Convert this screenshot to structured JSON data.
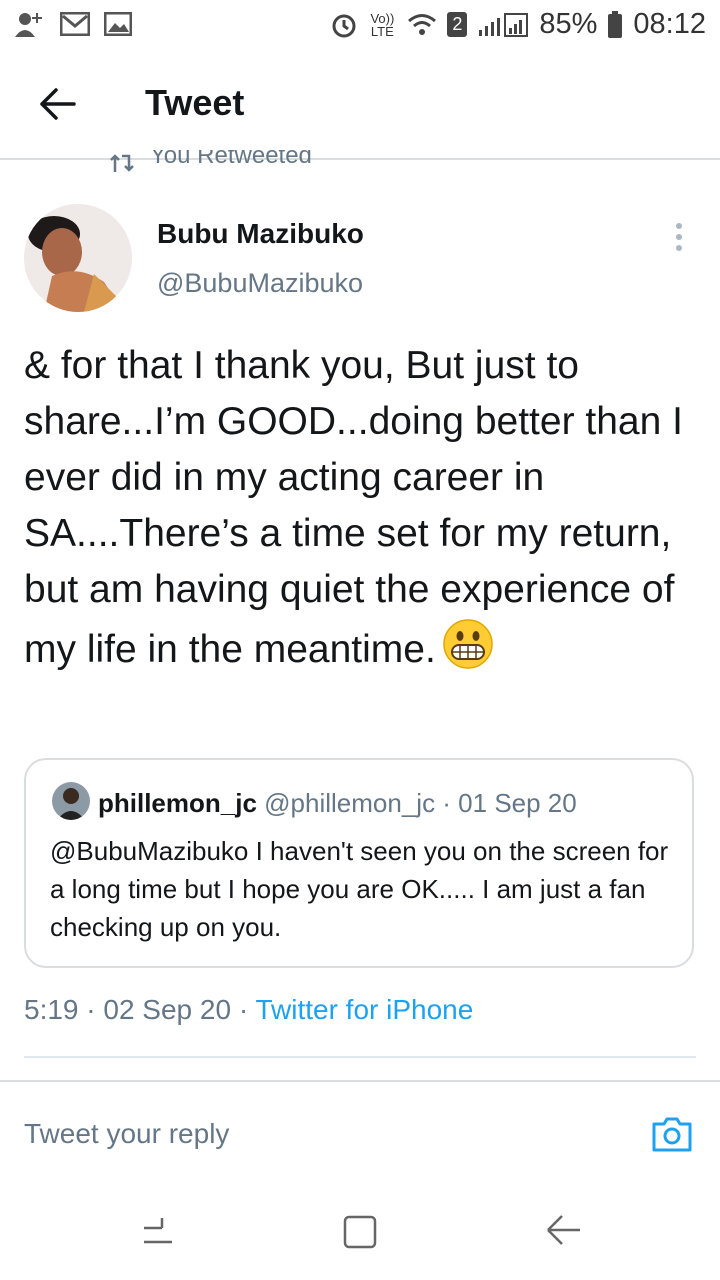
{
  "status_bar": {
    "volte": "Vo)) LTE",
    "sim": "2",
    "battery": "85%",
    "time": "08:12",
    "icons": [
      "add-contact-icon",
      "gmail-icon",
      "image-icon",
      "alarm-icon",
      "wifi-icon",
      "signal-icon",
      "battery-icon"
    ]
  },
  "header": {
    "title": "Tweet",
    "back_icon": "back-arrow-icon"
  },
  "retweet_notice": {
    "text": "You Retweeted",
    "icon": "retweet-icon"
  },
  "tweet": {
    "author_name": "Bubu Mazibuko",
    "author_handle": "@BubuMazibuko",
    "text": "& for that I thank you, But just to share...I’m GOOD...doing better than I ever did in my acting career in SA....There’s a time set for my return, but am having quiet the experience of my life in the meantime.",
    "emoji": "grinning-face-icon",
    "time": "5:19 · 02 Sep 20 · ",
    "source": "Twitter for iPhone"
  },
  "quoted_tweet": {
    "name": "phillemon_jc",
    "meta": "@phillemon_jc · 01 Sep 20",
    "text": "@BubuMazibuko I haven't seen you on the screen for a long time but I hope you are OK..... I am just a fan checking up on you."
  },
  "reply": {
    "placeholder": "Tweet your reply"
  },
  "colors": {
    "link": "#1da1f2",
    "muted": "#657786",
    "text": "#14171a"
  }
}
